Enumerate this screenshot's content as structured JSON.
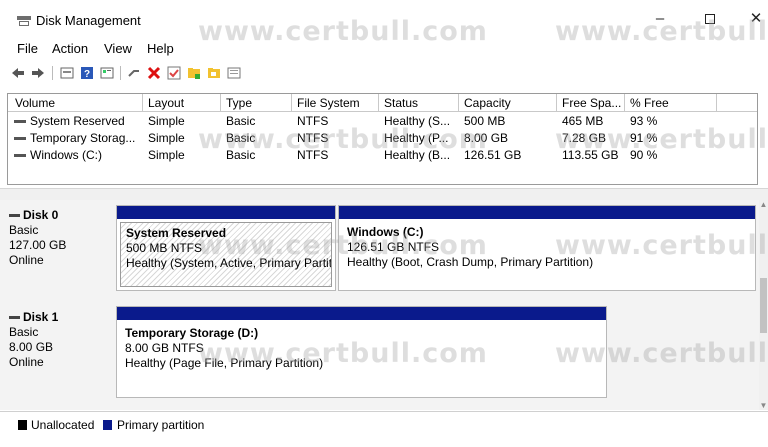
{
  "window": {
    "title": "Disk Management"
  },
  "menu": [
    "File",
    "Action",
    "View",
    "Help"
  ],
  "toolbar": {
    "icons": [
      "back-icon",
      "forward-icon",
      "disk-list-icon",
      "help-icon",
      "properties-icon",
      "connect-icon",
      "delete-icon",
      "check-icon",
      "folder-icon",
      "folder-open-icon",
      "view-icon"
    ]
  },
  "volumes": {
    "columns": [
      "Volume",
      "Layout",
      "Type",
      "File System",
      "Status",
      "Capacity",
      "Free Spa...",
      "% Free"
    ],
    "rows": [
      [
        "System Reserved",
        "Simple",
        "Basic",
        "NTFS",
        "Healthy (S...",
        "500 MB",
        "465 MB",
        "93 %"
      ],
      [
        "Temporary Storag...",
        "Simple",
        "Basic",
        "NTFS",
        "Healthy (P...",
        "8.00 GB",
        "7.28 GB",
        "91 %"
      ],
      [
        "Windows (C:)",
        "Simple",
        "Basic",
        "NTFS",
        "Healthy (B...",
        "126.51 GB",
        "113.55 GB",
        "90 %"
      ]
    ]
  },
  "disks": [
    {
      "name": "Disk 0",
      "type": "Basic",
      "size": "127.00 GB",
      "status": "Online",
      "partitions": [
        {
          "name": "System Reserved",
          "fs": "500 MB NTFS",
          "health": "Healthy (System, Active, Primary Partition)"
        },
        {
          "name": "Windows  (C:)",
          "fs": "126.51 GB NTFS",
          "health": "Healthy (Boot, Crash Dump, Primary Partition)"
        }
      ]
    },
    {
      "name": "Disk 1",
      "type": "Basic",
      "size": "8.00 GB",
      "status": "Online",
      "partitions": [
        {
          "name": "Temporary Storage  (D:)",
          "fs": "8.00 GB NTFS",
          "health": "Healthy (Page File, Primary Partition)"
        }
      ]
    }
  ],
  "legend": [
    {
      "label": "Unallocated",
      "color": "#000000"
    },
    {
      "label": "Primary partition",
      "color": "#0a1a8c"
    }
  ],
  "watermark": "www.certbull.com",
  "colors": {
    "partition_bar": "#0a1a8c",
    "unallocated": "#000000"
  }
}
